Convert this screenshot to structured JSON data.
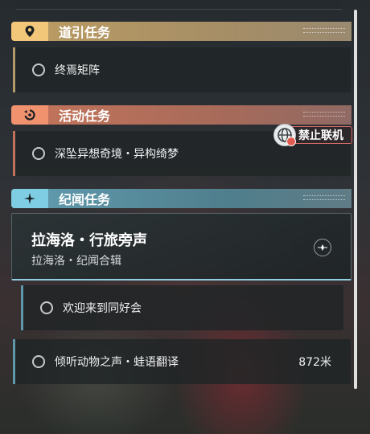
{
  "sections": {
    "guide": {
      "title": "道引任务",
      "icon": "location-pin-icon",
      "color": "#f2c779"
    },
    "activity": {
      "title": "活动任务",
      "icon": "refresh-icon",
      "color": "#f0926e"
    },
    "record": {
      "title": "纪闻任务",
      "icon": "sparkle-icon",
      "color": "#7ecde2"
    }
  },
  "quests": {
    "guide_1": {
      "name": "终焉矩阵"
    },
    "activity_1": {
      "name": "深坠异想奇境・异构绮梦"
    },
    "record_featured": {
      "name": "拉海洛・行旅旁声",
      "subtitle": "拉海洛・纪闻合辑"
    },
    "record_sub_1": {
      "name": "欢迎来到同好会"
    },
    "record_2": {
      "name": "倾听动物之声・蛙语翻译",
      "distance": "872米"
    }
  },
  "badge": {
    "no_online": "禁止联机",
    "alert_color": "#e25b4f"
  }
}
